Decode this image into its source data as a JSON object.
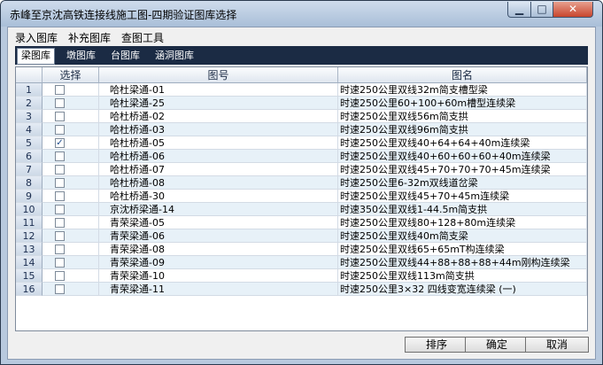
{
  "window": {
    "title": "赤峰至京沈高铁连接线施工图-四期验证图库选择"
  },
  "window_controls": {
    "minimize": "▁",
    "maximize": "□",
    "close": "✕"
  },
  "menubar": [
    "录入图库",
    "补充图库",
    "查图工具"
  ],
  "tabs": [
    "梁图库",
    "墩图库",
    "台图库",
    "涵洞图库"
  ],
  "active_tab": "梁图库",
  "table": {
    "headers": {
      "select": "选择",
      "code": "图号",
      "name": "图名"
    },
    "rows": [
      {
        "n": "1",
        "checked": false,
        "code": "哈杜梁通-01",
        "name": "时速250公里双线32m简支槽型梁"
      },
      {
        "n": "2",
        "checked": false,
        "code": "哈杜梁通-25",
        "name": "时速250公里60+100+60m槽型连续梁"
      },
      {
        "n": "3",
        "checked": false,
        "code": "哈杜桥通-02",
        "name": "时速250公里双线56m简支拱"
      },
      {
        "n": "4",
        "checked": false,
        "code": "哈杜桥通-03",
        "name": "时速250公里双线96m简支拱"
      },
      {
        "n": "5",
        "checked": true,
        "code": "哈杜桥通-05",
        "name": "时速250公里双线40+64+64+40m连续梁"
      },
      {
        "n": "6",
        "checked": false,
        "code": "哈杜桥通-06",
        "name": "时速250公里双线40+60+60+60+40m连续梁"
      },
      {
        "n": "7",
        "checked": false,
        "code": "哈杜桥通-07",
        "name": "时速250公里双线45+70+70+70+45m连续梁"
      },
      {
        "n": "8",
        "checked": false,
        "code": "哈杜桥通-08",
        "name": "时速250公里6-32m双线道岔梁"
      },
      {
        "n": "9",
        "checked": false,
        "code": "哈杜桥通-30",
        "name": "时速250公里双线45+70+45m连续梁"
      },
      {
        "n": "10",
        "checked": false,
        "code": "京沈桥梁通-14",
        "name": "时速350公里双线1-44.5m简支拱"
      },
      {
        "n": "11",
        "checked": false,
        "code": "青荣梁通-05",
        "name": "时速250公里双线80+128+80m连续梁"
      },
      {
        "n": "12",
        "checked": false,
        "code": "青荣梁通-06",
        "name": "时速250公里双线40m简支梁"
      },
      {
        "n": "13",
        "checked": false,
        "code": "青荣梁通-08",
        "name": "时速250公里双线65+65mT构连续梁"
      },
      {
        "n": "14",
        "checked": false,
        "code": "青荣梁通-09",
        "name": "时速250公里双线44+88+88+88+44m刚构连续梁"
      },
      {
        "n": "15",
        "checked": false,
        "code": "青荣梁通-10",
        "name": "时速250公里双线113m简支拱"
      },
      {
        "n": "16",
        "checked": false,
        "code": "青荣梁通-11",
        "name": "时速250公里3×32    四线变宽连续梁 (一)"
      }
    ]
  },
  "buttons": {
    "sort": "排序",
    "ok": "确定",
    "cancel": "取消"
  },
  "colors": {
    "tab_strip": "#1b2b44",
    "row_alt": "#e7f1f8",
    "close_button": "#c7452d"
  }
}
